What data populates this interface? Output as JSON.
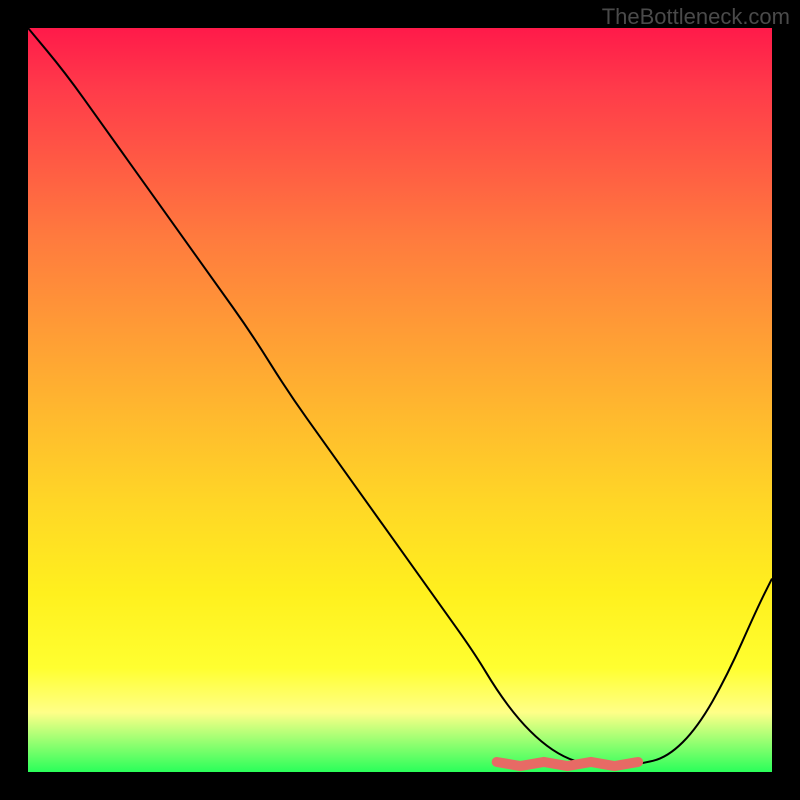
{
  "watermark": "TheBottleneck.com",
  "chart_data": {
    "type": "line",
    "title": "",
    "xlabel": "",
    "ylabel": "",
    "xlim": [
      0,
      100
    ],
    "ylim": [
      0,
      100
    ],
    "grid": false,
    "legend": false,
    "series": [
      {
        "name": "bottleneck-curve",
        "x": [
          0,
          5,
          10,
          15,
          20,
          25,
          30,
          35,
          40,
          45,
          50,
          55,
          60,
          63,
          66,
          69,
          72,
          75,
          78,
          82,
          86,
          90,
          94,
          98,
          100
        ],
        "values": [
          100,
          94,
          87,
          80,
          73,
          66,
          59,
          51,
          44,
          37,
          30,
          23,
          16,
          11,
          7,
          4,
          2,
          1,
          1,
          1,
          2,
          6,
          13,
          22,
          26
        ]
      }
    ],
    "optimal_range": {
      "x_start": 63,
      "x_end": 82
    },
    "background_gradient": {
      "top": "#ff1a4a",
      "middle": "#ffe021",
      "bottom": "#2aff5a"
    }
  }
}
